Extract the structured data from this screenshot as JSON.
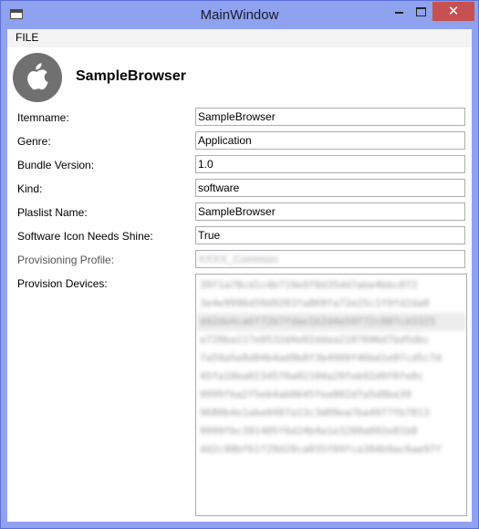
{
  "window": {
    "title": "MainWindow",
    "close_glyph": "✕"
  },
  "menu": {
    "file_label": "FILE"
  },
  "header": {
    "app_name": "SampleBrowser",
    "logo_icon": "apple-logo-icon"
  },
  "form": {
    "itemname": {
      "label": "Itemname:",
      "value": "SampleBrowser"
    },
    "genre": {
      "label": "Genre:",
      "value": "Application"
    },
    "bundle_version": {
      "label": "Bundle Version:",
      "value": "1.0"
    },
    "kind": {
      "label": "Kind:",
      "value": "software"
    },
    "playlist_name": {
      "label": "Plaslist Name:",
      "value": "SampleBrowser"
    },
    "icon_shine": {
      "label": "Software Icon Needs Shine:",
      "value": "True"
    },
    "provisioning_profile": {
      "label": "Provisioning Profile:",
      "value": "XXXX_Common"
    },
    "provision_devices": {
      "label": "Provision Devices:",
      "items": [
        "39f1a78cd1c4b719e9f0d35dd7abe4bbc072",
        "3e4e9996d59d9203fa869fa72e25c1f9fd2da0",
        "d42de4ca6f72b7fdae1b2d4e59f72c807cd3325",
        "e728ba117e0532d4e02ddaa2107696d7bd5dbc",
        "7a59a5e8d04b4ad9b8f3b4909f46bd1e07cd5c7d",
        "45fa18ba0234570a02104a29feb92d9f0fe0c",
        "9999fba2f5eb4ab0645fea802d7a5d8ba39",
        "9680b4e1abe0407a13c3d09ea7ba4977fb7813",
        "9999fbc391405f6d24b4a1e3209a092e81b8",
        "dd2c98bf61f29d20ca035f04fca304b9ac6ae97f"
      ]
    }
  }
}
